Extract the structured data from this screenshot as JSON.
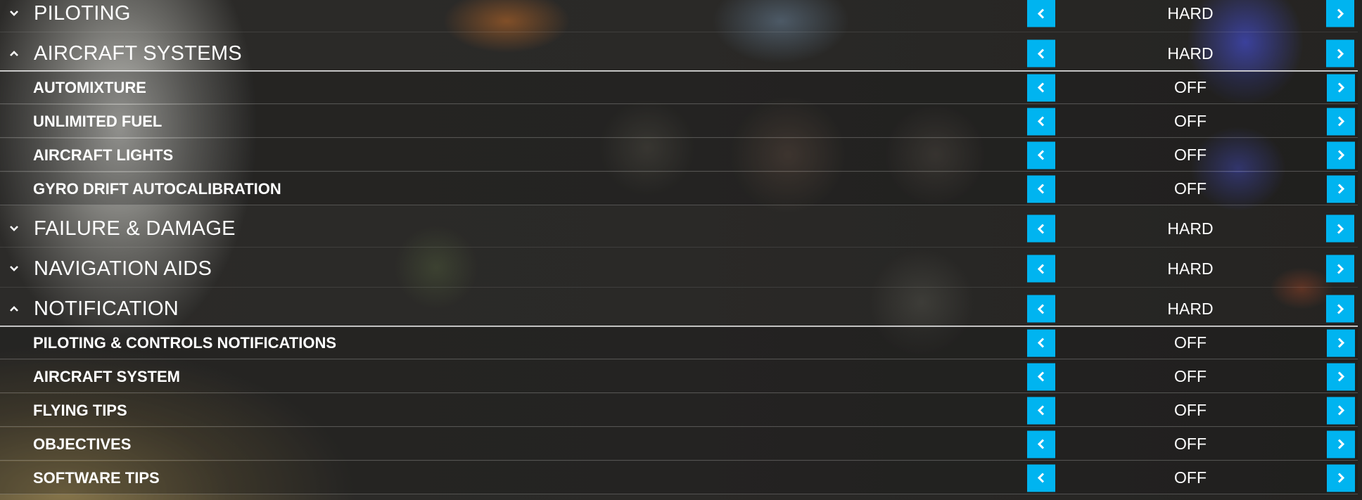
{
  "sections": [
    {
      "label": "PILOTING",
      "value": "HARD",
      "expanded": false
    },
    {
      "label": "AIRCRAFT SYSTEMS",
      "value": "HARD",
      "expanded": true,
      "items": [
        {
          "label": "AUTOMIXTURE",
          "value": "OFF"
        },
        {
          "label": "UNLIMITED FUEL",
          "value": "OFF"
        },
        {
          "label": "AIRCRAFT LIGHTS",
          "value": "OFF"
        },
        {
          "label": "GYRO DRIFT AUTOCALIBRATION",
          "value": "OFF"
        }
      ]
    },
    {
      "label": "FAILURE & DAMAGE",
      "value": "HARD",
      "expanded": false
    },
    {
      "label": "NAVIGATION AIDS",
      "value": "HARD",
      "expanded": false
    },
    {
      "label": "NOTIFICATION",
      "value": "HARD",
      "expanded": true,
      "items": [
        {
          "label": "PILOTING & CONTROLS NOTIFICATIONS",
          "value": "OFF"
        },
        {
          "label": "AIRCRAFT SYSTEM",
          "value": "OFF"
        },
        {
          "label": "FLYING TIPS",
          "value": "OFF"
        },
        {
          "label": "OBJECTIVES",
          "value": "OFF"
        },
        {
          "label": "SOFTWARE TIPS",
          "value": "OFF"
        }
      ]
    }
  ],
  "icons": {
    "collapsed": "chevron-down-icon",
    "expanded": "chevron-up-icon",
    "previous": "chevron-left-icon",
    "next": "chevron-right-icon"
  },
  "colors": {
    "accent": "#00b4f0",
    "text": "#ffffff"
  }
}
